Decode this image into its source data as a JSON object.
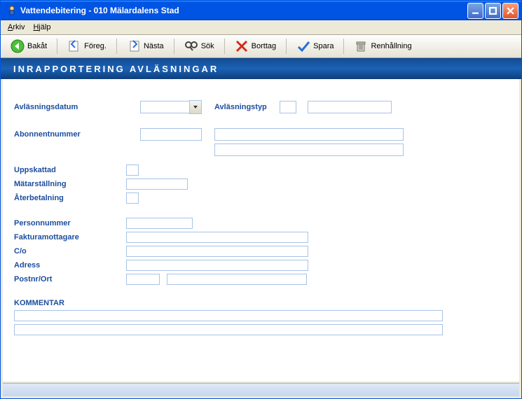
{
  "window": {
    "title": "Vattendebitering  -  010 Mälardalens Stad"
  },
  "menu": {
    "arkiv": "Arkiv",
    "hjalp": "Hjälp"
  },
  "toolbar": {
    "back": "Bakåt",
    "prev": "Föreg.",
    "next": "Nästa",
    "search": "Sök",
    "delete": "Borttag",
    "save": "Spara",
    "renhall": "Renhållning"
  },
  "header": {
    "title": "INRAPPORTERING AVLÄSNINGAR"
  },
  "form": {
    "avlasningsdatum_label": "Avläsningsdatum",
    "avlasningsdatum_value": "",
    "avlasningstyp_label": "Avläsningstyp",
    "avlasningstyp_code": "",
    "avlasningstyp_text": "",
    "abonnentnummer_label": "Abonnentnummer",
    "abonnentnummer_value": "",
    "abonnent_line1": "",
    "abonnent_line2": "",
    "uppskattad_label": "Uppskattad",
    "uppskattad_value": "",
    "matarstallning_label": "Mätarställning",
    "matarstallning_value": "",
    "aterbetalning_label": "Återbetalning",
    "aterbetalning_value": "",
    "personnummer_label": "Personnummer",
    "personnummer_value": "",
    "fakturamottagare_label": "Fakturamottagare",
    "fakturamottagare_value": "",
    "co_label": "C/o",
    "co_value": "",
    "adress_label": "Adress",
    "adress_value": "",
    "postnrort_label": "Postnr/Ort",
    "postnr_value": "",
    "ort_value": "",
    "kommentar_label": "KOMMENTAR",
    "kommentar_line1": "",
    "kommentar_line2": ""
  }
}
